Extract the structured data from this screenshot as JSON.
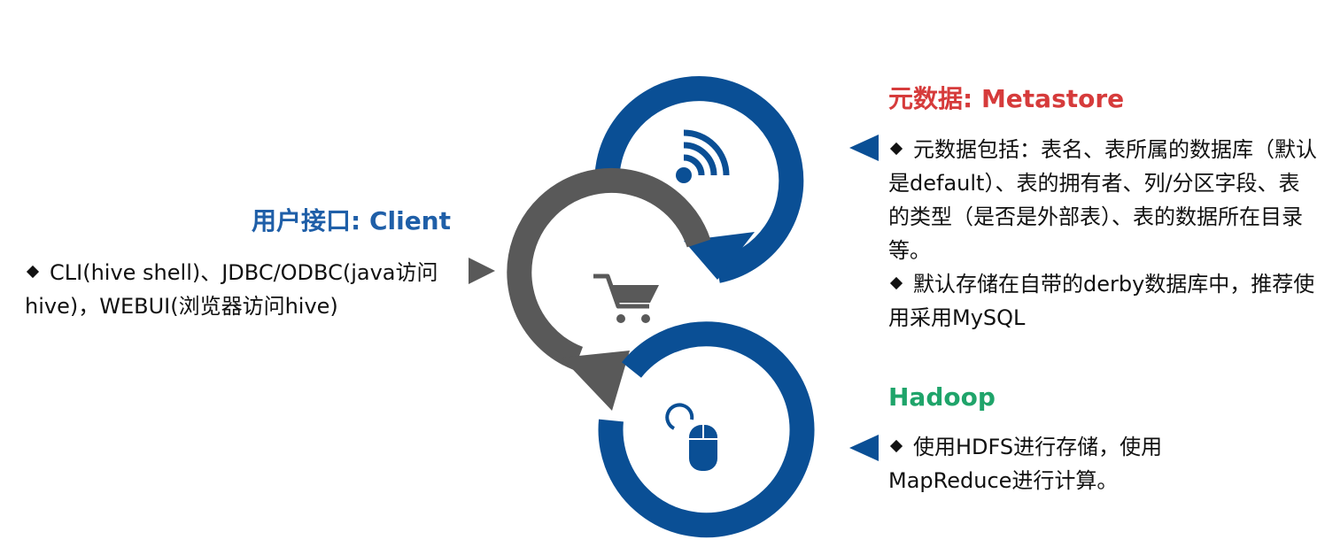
{
  "colors": {
    "client_title": "#1f5fa8",
    "metastore_title": "#d63b3b",
    "hadoop_title": "#1fa46a",
    "blue_ring": "#0a4f95",
    "gray_ring": "#595959"
  },
  "client": {
    "title": "用户接口: Client",
    "text": "CLI(hive shell)、JDBC/ODBC(java访问hive)，WEBUI(浏览器访问hive)"
  },
  "metastore": {
    "title": "元数据: Metastore",
    "points": [
      "元数据包括：表名、表所属的数据库（默认是default）、表的拥有者、列/分区字段、表的类型（是否是外部表）、表的数据所在目录等。",
      "默认存储在自带的derby数据库中，推荐使用采用MySQL"
    ]
  },
  "hadoop": {
    "title": "Hadoop",
    "text": "使用HDFS进行存储，使用MapReduce进行计算。"
  },
  "icons": [
    "wifi-icon",
    "shopping-cart-icon",
    "mouse-icon"
  ]
}
